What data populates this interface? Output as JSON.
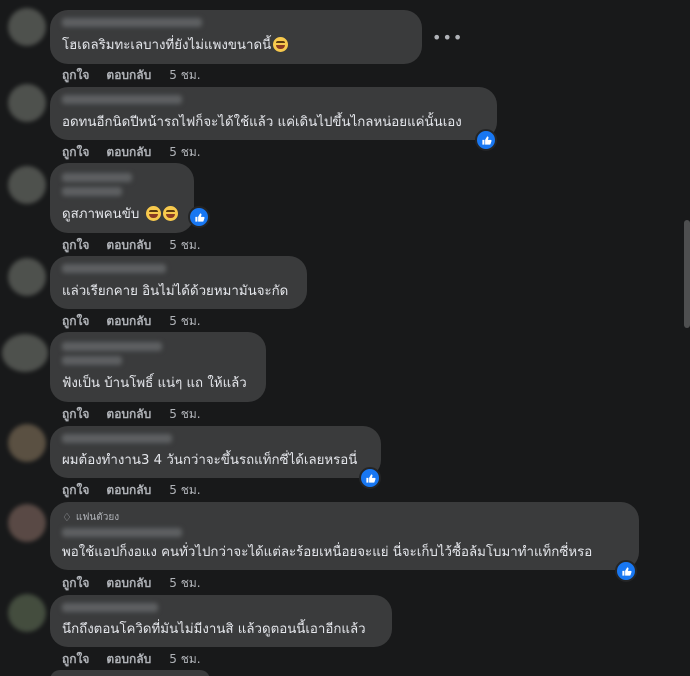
{
  "actions": {
    "like": "ถูกใจ",
    "reply": "ตอบกลับ"
  },
  "comments": [
    {
      "text": "โฮเดลริมทะเลบางที่ยังไม่แพงขนาดนี้",
      "time": "5 ชม.",
      "has_like_reaction": false,
      "emojis": [
        "laughing-face"
      ]
    },
    {
      "text": "อดทนอีกนิดปีหน้ารถไฟก็จะได้ใช้แล้ว แค่เดินไปขึ้นไกลหน่อยแค่นั้นเอง",
      "time": "5 ชม.",
      "has_like_reaction": true
    },
    {
      "text": "ดูสภาพคนขับ",
      "time": "5 ชม.",
      "has_like_reaction": true,
      "emojis": [
        "laughing-face",
        "laughing-face"
      ]
    },
    {
      "text": "แล่วเรียกคาย อินไม่ได้ด้วยหมามันจะกัด",
      "time": "5 ชม.",
      "has_like_reaction": false
    },
    {
      "text": "ฟังเป็น บ้านโพธิ์ แน่ๆ แถ ให้แล้ว",
      "time": "5 ชม.",
      "has_like_reaction": false
    },
    {
      "text": "ผมต้องทำงาน3 4 วันกว่าจะขึ้นรถแท็กซี่ได้เลยหรอนี่",
      "time": "5 ชม.",
      "has_like_reaction": true
    },
    {
      "badge": "แฟนตัวยง",
      "text": "พอใช้แอปก็งอแง คนทั่วไปกว่าจะได้แต่ละร้อยเหนื่อยจะแย่ นี่จะเก็บไว้ซื้อล้มโบมาทำแท็กซี่หรอ",
      "time": "5 ชม.",
      "has_like_reaction": true
    },
    {
      "text": "นึกถึงตอนโควิดที่มันไม่มีงานสิ แล้วดูตอนนี้เอาอีกแล้ว",
      "time": "5 ชม.",
      "has_like_reaction": false
    }
  ],
  "more_icon": "more-options-icon",
  "colors": {
    "background": "#18191a",
    "bubble": "#3a3b3c",
    "text": "#e4e6eb",
    "secondary": "#b0b3b8",
    "like_blue": "#1877f2"
  }
}
